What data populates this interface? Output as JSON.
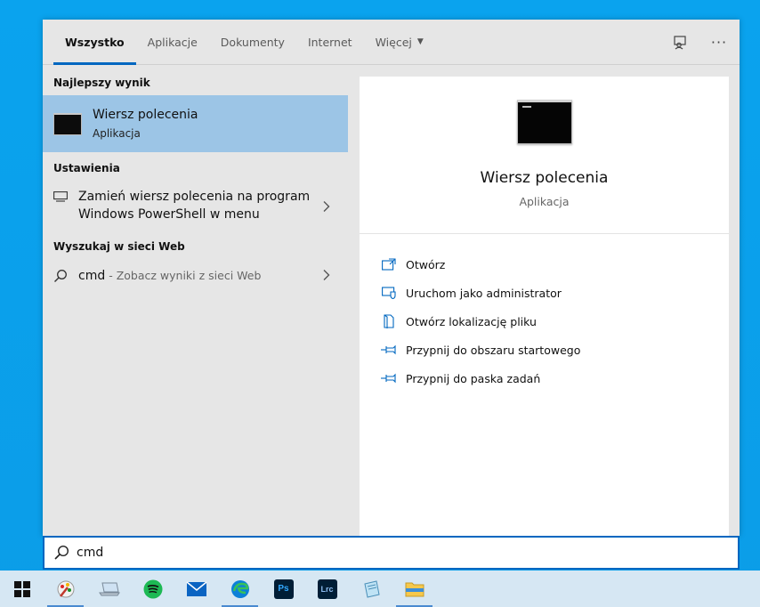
{
  "tabs": [
    {
      "label": "Wszystko",
      "active": true
    },
    {
      "label": "Aplikacje"
    },
    {
      "label": "Dokumenty"
    },
    {
      "label": "Internet"
    },
    {
      "label": "Więcej"
    }
  ],
  "tools": {
    "feedback_icon": "feedback-icon",
    "more_icon": "more-options-icon",
    "more_glyph": "···"
  },
  "results": {
    "best_match_header": "Najlepszy wynik",
    "best_match": {
      "title": "Wiersz polecenia",
      "subtitle": "Aplikacja"
    },
    "settings_header": "Ustawienia",
    "settings_item": {
      "label": "Zamień wiersz polecenia na program Windows PowerShell w menu"
    },
    "web_header": "Wyszukaj w sieci Web",
    "web_item": {
      "query": "cmd",
      "suffix": " - Zobacz wyniki z sieci Web"
    }
  },
  "detail": {
    "title": "Wiersz polecenia",
    "subtitle": "Aplikacja",
    "actions": [
      {
        "label": "Otwórz",
        "icon": "open-icon"
      },
      {
        "label": "Uruchom jako administrator",
        "icon": "shield-icon"
      },
      {
        "label": "Otwórz lokalizację pliku",
        "icon": "file-location-icon"
      },
      {
        "label": "Przypnij do obszaru startowego",
        "icon": "pin-icon"
      },
      {
        "label": "Przypnij do paska zadań",
        "icon": "pin-icon"
      }
    ]
  },
  "search": {
    "value": "cmd"
  },
  "taskbar": {
    "items": [
      "windows-start-icon",
      "paint-icon",
      "laptop-icon",
      "spotify-icon",
      "mail-icon",
      "edge-icon",
      "photoshop-icon",
      "lightroom-icon",
      "notepad-icon",
      "file-explorer-icon"
    ],
    "ps_label": "Ps",
    "lrc_label": "Lrc"
  },
  "colors": {
    "accent": "#0067c0",
    "selected_bg": "#9cc5e6",
    "desktop": "#0aa3ee",
    "taskbar": "#d6e7f3"
  }
}
